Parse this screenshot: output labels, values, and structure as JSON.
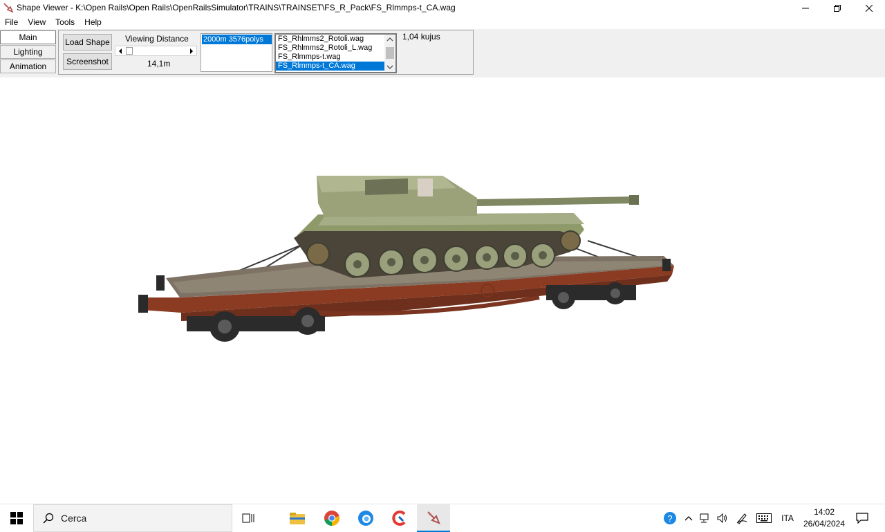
{
  "window": {
    "title": "Shape Viewer - K:\\Open Rails\\Open Rails\\OpenRailsSimulator\\TRAINS\\TRAINSET\\FS_R_Pack\\FS_Rlmmps-t_CA.wag"
  },
  "menu": [
    "File",
    "View",
    "Tools",
    "Help"
  ],
  "side_tabs": [
    {
      "label": "Main",
      "active": true
    },
    {
      "label": "Lighting",
      "active": false
    },
    {
      "label": "Animation",
      "active": false
    }
  ],
  "controls": {
    "load_shape_label": "Load Shape",
    "screenshot_label": "Screenshot",
    "viewing_distance_label": "Viewing Distance",
    "viewing_distance_value": "14,1m",
    "lod_selected": "2000m 3576polys",
    "files": [
      {
        "name": "FS_Rhlmms2_Rotoli.wag",
        "selected": false
      },
      {
        "name": "FS_Rhlmms2_Rotoli_L.wag",
        "selected": false
      },
      {
        "name": "FS_Rlmmps-t.wag",
        "selected": false
      },
      {
        "name": "FS_Rlmmps-t_CA.wag",
        "selected": true
      }
    ],
    "status_text": "1,04 kujus"
  },
  "taskbar": {
    "search_placeholder": "Cerca",
    "language": "ITA",
    "time": "14:02",
    "date": "26/04/2024",
    "apps": [
      "task-view-icon",
      "file-explorer-icon",
      "chrome-icon",
      "edge-icon",
      "ccleaner-icon",
      "shape-viewer-app-icon"
    ]
  },
  "colors": {
    "selection": "#0078d7",
    "toolbar_bg": "#f0f0f0",
    "wagon_body": "#8a3b22",
    "tank_green": "#8e9a6a"
  }
}
